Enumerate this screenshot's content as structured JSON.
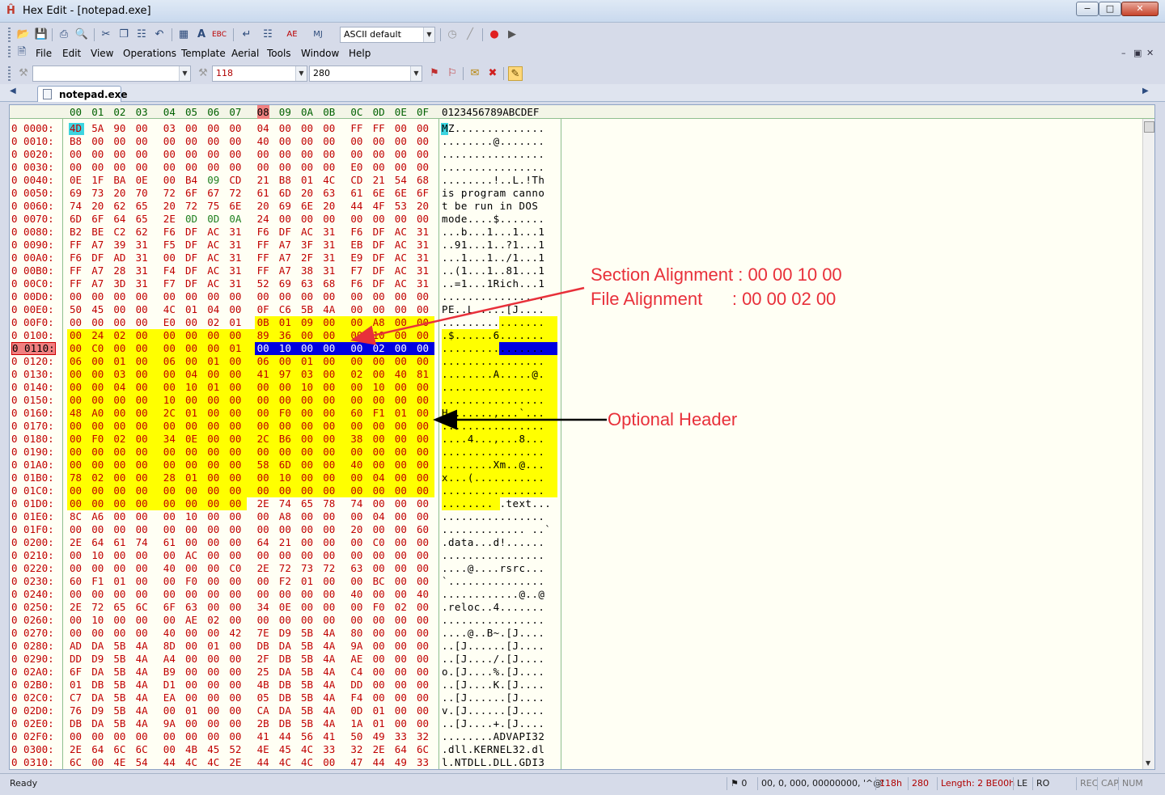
{
  "window": {
    "title": "Hex Edit - [notepad.exe]",
    "min": "−",
    "max": "□",
    "close": "✕",
    "app_icon": "Ĥ"
  },
  "toolbar": {
    "char_set": "ASCII default",
    "find_placeholder": "",
    "address_hex": "118",
    "address_dec": "280",
    "icons": [
      "open-icon",
      "save-icon",
      "print-icon",
      "preview-icon",
      "cut-icon",
      "copy-icon",
      "paste-icon",
      "undo-icon",
      "calc-icon",
      "font-size-icon",
      "ebcdic-icon",
      "wrap-icon",
      "aerial-icon",
      "bookmark-icon",
      "record-icon",
      "play-icon"
    ]
  },
  "menu": {
    "items": [
      "File",
      "Edit",
      "View",
      "Operations",
      "Template",
      "Aerial",
      "Tools",
      "Window",
      "Help"
    ],
    "mdi_min": "–",
    "mdi_restore": "▣",
    "mdi_close": "✕"
  },
  "tabs": {
    "active": "notepad.exe",
    "left": "◀",
    "right": "▶"
  },
  "editor": {
    "col_headers": [
      "00",
      "01",
      "02",
      "03",
      "04",
      "05",
      "06",
      "07",
      "08",
      "09",
      "0A",
      "0B",
      "0C",
      "0D",
      "0E",
      "0F"
    ],
    "ascii_header": "0123456789ABCDEF",
    "current_column": "08",
    "current_row": "0 0110:",
    "rows": [
      {
        "a": "0 0000:",
        "h": [
          "4D",
          "5A",
          "90",
          "00",
          "03",
          "00",
          "00",
          "00",
          "04",
          "00",
          "00",
          "00",
          "FF",
          "FF",
          "00",
          "00"
        ],
        "t": "MZ.............."
      },
      {
        "a": "0 0010:",
        "h": [
          "B8",
          "00",
          "00",
          "00",
          "00",
          "00",
          "00",
          "00",
          "40",
          "00",
          "00",
          "00",
          "00",
          "00",
          "00",
          "00"
        ],
        "t": "........@......."
      },
      {
        "a": "0 0020:",
        "h": [
          "00",
          "00",
          "00",
          "00",
          "00",
          "00",
          "00",
          "00",
          "00",
          "00",
          "00",
          "00",
          "00",
          "00",
          "00",
          "00"
        ],
        "t": "................"
      },
      {
        "a": "0 0030:",
        "h": [
          "00",
          "00",
          "00",
          "00",
          "00",
          "00",
          "00",
          "00",
          "00",
          "00",
          "00",
          "00",
          "E0",
          "00",
          "00",
          "00"
        ],
        "t": "................"
      },
      {
        "a": "0 0040:",
        "h": [
          "0E",
          "1F",
          "BA",
          "0E",
          "00",
          "B4",
          "09",
          "CD",
          "21",
          "B8",
          "01",
          "4C",
          "CD",
          "21",
          "54",
          "68"
        ],
        "t": "........!..L.!Th"
      },
      {
        "a": "0 0050:",
        "h": [
          "69",
          "73",
          "20",
          "70",
          "72",
          "6F",
          "67",
          "72",
          "61",
          "6D",
          "20",
          "63",
          "61",
          "6E",
          "6E",
          "6F"
        ],
        "t": "is program canno"
      },
      {
        "a": "0 0060:",
        "h": [
          "74",
          "20",
          "62",
          "65",
          "20",
          "72",
          "75",
          "6E",
          "20",
          "69",
          "6E",
          "20",
          "44",
          "4F",
          "53",
          "20"
        ],
        "t": "t be run in DOS "
      },
      {
        "a": "0 0070:",
        "h": [
          "6D",
          "6F",
          "64",
          "65",
          "2E",
          "0D",
          "0D",
          "0A",
          "24",
          "00",
          "00",
          "00",
          "00",
          "00",
          "00",
          "00"
        ],
        "t": "mode....$......."
      },
      {
        "a": "0 0080:",
        "h": [
          "B2",
          "BE",
          "C2",
          "62",
          "F6",
          "DF",
          "AC",
          "31",
          "F6",
          "DF",
          "AC",
          "31",
          "F6",
          "DF",
          "AC",
          "31"
        ],
        "t": "...b...1...1...1"
      },
      {
        "a": "0 0090:",
        "h": [
          "FF",
          "A7",
          "39",
          "31",
          "F5",
          "DF",
          "AC",
          "31",
          "FF",
          "A7",
          "3F",
          "31",
          "EB",
          "DF",
          "AC",
          "31"
        ],
        "t": "..91...1..?1...1"
      },
      {
        "a": "0 00A0:",
        "h": [
          "F6",
          "DF",
          "AD",
          "31",
          "00",
          "DF",
          "AC",
          "31",
          "FF",
          "A7",
          "2F",
          "31",
          "E9",
          "DF",
          "AC",
          "31"
        ],
        "t": "...1...1../1...1"
      },
      {
        "a": "0 00B0:",
        "h": [
          "FF",
          "A7",
          "28",
          "31",
          "F4",
          "DF",
          "AC",
          "31",
          "FF",
          "A7",
          "38",
          "31",
          "F7",
          "DF",
          "AC",
          "31"
        ],
        "t": "..(1...1..81...1"
      },
      {
        "a": "0 00C0:",
        "h": [
          "FF",
          "A7",
          "3D",
          "31",
          "F7",
          "DF",
          "AC",
          "31",
          "52",
          "69",
          "63",
          "68",
          "F6",
          "DF",
          "AC",
          "31"
        ],
        "t": "..=1...1Rich...1"
      },
      {
        "a": "0 00D0:",
        "h": [
          "00",
          "00",
          "00",
          "00",
          "00",
          "00",
          "00",
          "00",
          "00",
          "00",
          "00",
          "00",
          "00",
          "00",
          "00",
          "00"
        ],
        "t": "................"
      },
      {
        "a": "0 00E0:",
        "h": [
          "50",
          "45",
          "00",
          "00",
          "4C",
          "01",
          "04",
          "00",
          "0F",
          "C6",
          "5B",
          "4A",
          "00",
          "00",
          "00",
          "00"
        ],
        "t": "PE..L.....[J...."
      },
      {
        "a": "0 00F0:",
        "h": [
          "00",
          "00",
          "00",
          "00",
          "E0",
          "00",
          "02",
          "01",
          "0B",
          "01",
          "09",
          "00",
          "00",
          "A8",
          "00",
          "00"
        ],
        "t": "................"
      },
      {
        "a": "0 0100:",
        "h": [
          "00",
          "24",
          "02",
          "00",
          "00",
          "00",
          "00",
          "00",
          "89",
          "36",
          "00",
          "00",
          "00",
          "10",
          "00",
          "00"
        ],
        "t": ".$......6......."
      },
      {
        "a": "0 0110:",
        "h": [
          "00",
          "C0",
          "00",
          "00",
          "00",
          "00",
          "00",
          "01",
          "00",
          "10",
          "00",
          "00",
          "00",
          "02",
          "00",
          "00"
        ],
        "t": "................"
      },
      {
        "a": "0 0120:",
        "h": [
          "06",
          "00",
          "01",
          "00",
          "06",
          "00",
          "01",
          "00",
          "06",
          "00",
          "01",
          "00",
          "00",
          "00",
          "00",
          "00"
        ],
        "t": "................"
      },
      {
        "a": "0 0130:",
        "h": [
          "00",
          "00",
          "03",
          "00",
          "00",
          "04",
          "00",
          "00",
          "41",
          "97",
          "03",
          "00",
          "02",
          "00",
          "40",
          "81"
        ],
        "t": "........A.....@."
      },
      {
        "a": "0 0140:",
        "h": [
          "00",
          "00",
          "04",
          "00",
          "00",
          "10",
          "01",
          "00",
          "00",
          "00",
          "10",
          "00",
          "00",
          "10",
          "00",
          "00"
        ],
        "t": "................"
      },
      {
        "a": "0 0150:",
        "h": [
          "00",
          "00",
          "00",
          "00",
          "10",
          "00",
          "00",
          "00",
          "00",
          "00",
          "00",
          "00",
          "00",
          "00",
          "00",
          "00"
        ],
        "t": "................"
      },
      {
        "a": "0 0160:",
        "h": [
          "48",
          "A0",
          "00",
          "00",
          "2C",
          "01",
          "00",
          "00",
          "00",
          "F0",
          "00",
          "00",
          "60",
          "F1",
          "01",
          "00"
        ],
        "t": "H.......,...`..."
      },
      {
        "a": "0 0170:",
        "h": [
          "00",
          "00",
          "00",
          "00",
          "00",
          "00",
          "00",
          "00",
          "00",
          "00",
          "00",
          "00",
          "00",
          "00",
          "00",
          "00"
        ],
        "t": "................"
      },
      {
        "a": "0 0180:",
        "h": [
          "00",
          "F0",
          "02",
          "00",
          "34",
          "0E",
          "00",
          "00",
          "2C",
          "B6",
          "00",
          "00",
          "38",
          "00",
          "00",
          "00"
        ],
        "t": "....4...,...8..."
      },
      {
        "a": "0 0190:",
        "h": [
          "00",
          "00",
          "00",
          "00",
          "00",
          "00",
          "00",
          "00",
          "00",
          "00",
          "00",
          "00",
          "00",
          "00",
          "00",
          "00"
        ],
        "t": "................"
      },
      {
        "a": "0 01A0:",
        "h": [
          "00",
          "00",
          "00",
          "00",
          "00",
          "00",
          "00",
          "00",
          "58",
          "6D",
          "00",
          "00",
          "40",
          "00",
          "00",
          "00"
        ],
        "t": "........Xm..@..."
      },
      {
        "a": "0 01B0:",
        "h": [
          "78",
          "02",
          "00",
          "00",
          "28",
          "01",
          "00",
          "00",
          "00",
          "10",
          "00",
          "00",
          "00",
          "04",
          "00",
          "00"
        ],
        "t": "x...(..........."
      },
      {
        "a": "0 01C0:",
        "h": [
          "00",
          "00",
          "00",
          "00",
          "00",
          "00",
          "00",
          "00",
          "00",
          "00",
          "00",
          "00",
          "00",
          "00",
          "00",
          "00"
        ],
        "t": "................"
      },
      {
        "a": "0 01D0:",
        "h": [
          "00",
          "00",
          "00",
          "00",
          "00",
          "00",
          "00",
          "00",
          "2E",
          "74",
          "65",
          "78",
          "74",
          "00",
          "00",
          "00"
        ],
        "t": "........ .text..."
      },
      {
        "a": "0 01E0:",
        "h": [
          "8C",
          "A6",
          "00",
          "00",
          "00",
          "10",
          "00",
          "00",
          "00",
          "A8",
          "00",
          "00",
          "00",
          "04",
          "00",
          "00"
        ],
        "t": "................"
      },
      {
        "a": "0 01F0:",
        "h": [
          "00",
          "00",
          "00",
          "00",
          "00",
          "00",
          "00",
          "00",
          "00",
          "00",
          "00",
          "00",
          "20",
          "00",
          "00",
          "60"
        ],
        "t": "............. ..`"
      },
      {
        "a": "0 0200:",
        "h": [
          "2E",
          "64",
          "61",
          "74",
          "61",
          "00",
          "00",
          "00",
          "64",
          "21",
          "00",
          "00",
          "00",
          "C0",
          "00",
          "00"
        ],
        "t": ".data...d!......"
      },
      {
        "a": "0 0210:",
        "h": [
          "00",
          "10",
          "00",
          "00",
          "00",
          "AC",
          "00",
          "00",
          "00",
          "00",
          "00",
          "00",
          "00",
          "00",
          "00",
          "00"
        ],
        "t": "................"
      },
      {
        "a": "0 0220:",
        "h": [
          "00",
          "00",
          "00",
          "00",
          "40",
          "00",
          "00",
          "C0",
          "2E",
          "72",
          "73",
          "72",
          "63",
          "00",
          "00",
          "00"
        ],
        "t": "....@....rsrc..."
      },
      {
        "a": "0 0230:",
        "h": [
          "60",
          "F1",
          "01",
          "00",
          "00",
          "F0",
          "00",
          "00",
          "00",
          "F2",
          "01",
          "00",
          "00",
          "BC",
          "00",
          "00"
        ],
        "t": "`..............."
      },
      {
        "a": "0 0240:",
        "h": [
          "00",
          "00",
          "00",
          "00",
          "00",
          "00",
          "00",
          "00",
          "00",
          "00",
          "00",
          "00",
          "40",
          "00",
          "00",
          "40"
        ],
        "t": "............@..@"
      },
      {
        "a": "0 0250:",
        "h": [
          "2E",
          "72",
          "65",
          "6C",
          "6F",
          "63",
          "00",
          "00",
          "34",
          "0E",
          "00",
          "00",
          "00",
          "F0",
          "02",
          "00"
        ],
        "t": ".reloc..4......."
      },
      {
        "a": "0 0260:",
        "h": [
          "00",
          "10",
          "00",
          "00",
          "00",
          "AE",
          "02",
          "00",
          "00",
          "00",
          "00",
          "00",
          "00",
          "00",
          "00",
          "00"
        ],
        "t": "................"
      },
      {
        "a": "0 0270:",
        "h": [
          "00",
          "00",
          "00",
          "00",
          "40",
          "00",
          "00",
          "42",
          "7E",
          "D9",
          "5B",
          "4A",
          "80",
          "00",
          "00",
          "00"
        ],
        "t": "....@..B~.[J...."
      },
      {
        "a": "0 0280:",
        "h": [
          "AD",
          "DA",
          "5B",
          "4A",
          "8D",
          "00",
          "01",
          "00",
          "DB",
          "DA",
          "5B",
          "4A",
          "9A",
          "00",
          "00",
          "00"
        ],
        "t": "..[J......[J...."
      },
      {
        "a": "0 0290:",
        "h": [
          "DD",
          "D9",
          "5B",
          "4A",
          "A4",
          "00",
          "00",
          "00",
          "2F",
          "DB",
          "5B",
          "4A",
          "AE",
          "00",
          "00",
          "00"
        ],
        "t": "..[J..../.[J...."
      },
      {
        "a": "0 02A0:",
        "h": [
          "6F",
          "DA",
          "5B",
          "4A",
          "B9",
          "00",
          "00",
          "00",
          "25",
          "DA",
          "5B",
          "4A",
          "C4",
          "00",
          "00",
          "00"
        ],
        "t": "o.[J....%.[J...."
      },
      {
        "a": "0 02B0:",
        "h": [
          "01",
          "DB",
          "5B",
          "4A",
          "D1",
          "00",
          "00",
          "00",
          "4B",
          "DB",
          "5B",
          "4A",
          "DD",
          "00",
          "00",
          "00"
        ],
        "t": "..[J....K.[J...."
      },
      {
        "a": "0 02C0:",
        "h": [
          "C7",
          "DA",
          "5B",
          "4A",
          "EA",
          "00",
          "00",
          "00",
          "05",
          "DB",
          "5B",
          "4A",
          "F4",
          "00",
          "00",
          "00"
        ],
        "t": "..[J......[J...."
      },
      {
        "a": "0 02D0:",
        "h": [
          "76",
          "D9",
          "5B",
          "4A",
          "00",
          "01",
          "00",
          "00",
          "CA",
          "DA",
          "5B",
          "4A",
          "0D",
          "01",
          "00",
          "00"
        ],
        "t": "v.[J......[J...."
      },
      {
        "a": "0 02E0:",
        "h": [
          "DB",
          "DA",
          "5B",
          "4A",
          "9A",
          "00",
          "00",
          "00",
          "2B",
          "DB",
          "5B",
          "4A",
          "1A",
          "01",
          "00",
          "00"
        ],
        "t": "..[J....+.[J...."
      },
      {
        "a": "0 02F0:",
        "h": [
          "00",
          "00",
          "00",
          "00",
          "00",
          "00",
          "00",
          "00",
          "41",
          "44",
          "56",
          "41",
          "50",
          "49",
          "33",
          "32"
        ],
        "t": "........ADVAPI32"
      },
      {
        "a": "0 0300:",
        "h": [
          "2E",
          "64",
          "6C",
          "6C",
          "00",
          "4B",
          "45",
          "52",
          "4E",
          "45",
          "4C",
          "33",
          "32",
          "2E",
          "64",
          "6C"
        ],
        "t": ".dll.KERNEL32.dl"
      },
      {
        "a": "0 0310:",
        "h": [
          "6C",
          "00",
          "4E",
          "54",
          "44",
          "4C",
          "4C",
          "2E",
          "44",
          "4C",
          "4C",
          "00",
          "47",
          "44",
          "49",
          "33"
        ],
        "t": "l.NTDLL.DLL.GDI3"
      }
    ]
  },
  "annotations": {
    "section_alignment": "Section Alignment : 00 00 10 00",
    "file_alignment": "File Alignment      : 00 00 02 00",
    "optional_header": "Optional Header",
    "color": "#e8303a"
  },
  "status": {
    "ready": "Ready",
    "bookmarks": "0",
    "data_values": "00, 0, 000, 00000000, '^@'",
    "offset_hex": "118h",
    "offset_dec": "280",
    "length": "Length: 2 BE00h",
    "endian": "LE",
    "ro": "RO",
    "rec": "REC",
    "cap": "CAP",
    "num": "NUM"
  },
  "colors": {
    "highlight": "#ffff00",
    "selection": "#0000e0",
    "hex_text": "#c00000",
    "cursor": "#3dd5e0"
  }
}
